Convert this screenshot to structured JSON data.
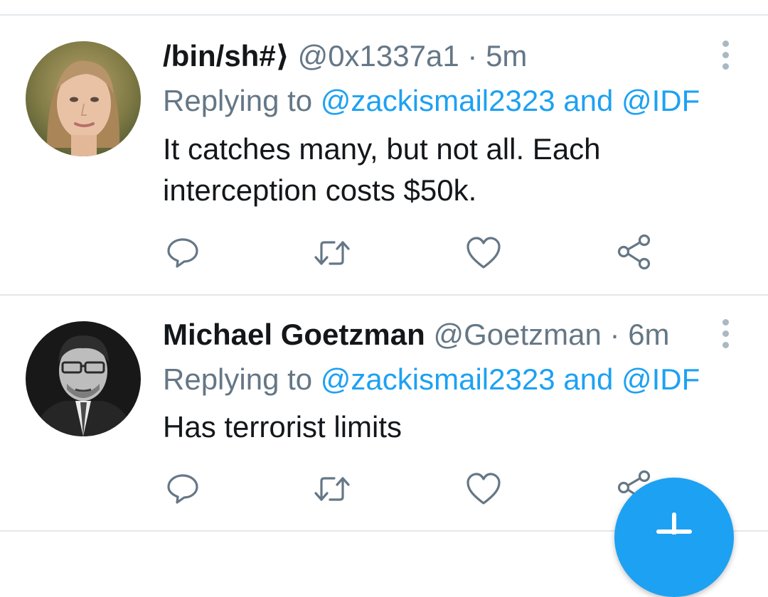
{
  "colors": {
    "accent": "#1da1f2",
    "muted": "#657786",
    "text": "#14171a",
    "divider": "#e4e8eb"
  },
  "tweets": [
    {
      "display_name": "/bin/sh#⟩",
      "handle": "@0x1337a1",
      "separator": "·",
      "time": "5m",
      "replying_prefix": "Replying to",
      "reply_user_1": "@zackismail2323",
      "reply_and": "and",
      "reply_user_2": "@IDF",
      "text": "It catches many, but not all. Each interception costs $50k.",
      "avatar_icon": "user-photo-woman"
    },
    {
      "display_name": "Michael Goetzman",
      "handle": "@Goetzman",
      "separator": "·",
      "time": "6m",
      "replying_prefix": "Replying to",
      "reply_user_1": "@zackismail2323",
      "reply_and": "and",
      "reply_user_2": "@IDF",
      "text": "Has terrorist limits",
      "avatar_icon": "user-photo-man"
    }
  ],
  "actions": [
    "reply-icon",
    "retweet-icon",
    "like-icon",
    "share-icon"
  ],
  "fab": {
    "icon": "compose-plus-icon"
  }
}
